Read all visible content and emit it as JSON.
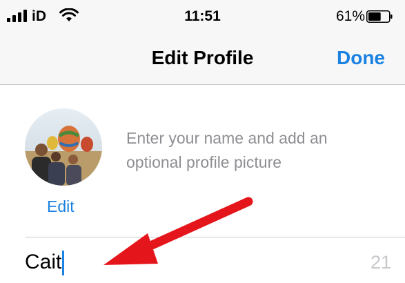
{
  "status_bar": {
    "carrier": "iD",
    "time": "11:51",
    "battery": "61%",
    "battery_level": 0.61
  },
  "nav": {
    "title": "Edit Profile",
    "done_label": "Done"
  },
  "profile": {
    "hint": "Enter your name and add an optional profile picture",
    "edit_label": "Edit",
    "name_value": "Cait",
    "chars_remaining": "21"
  },
  "colors": {
    "accent": "#1a82e2",
    "annotation": "#e5161b",
    "hint": "#8e8e93"
  },
  "icons": [
    "cellular-signal-icon",
    "wifi-icon",
    "battery-icon"
  ]
}
